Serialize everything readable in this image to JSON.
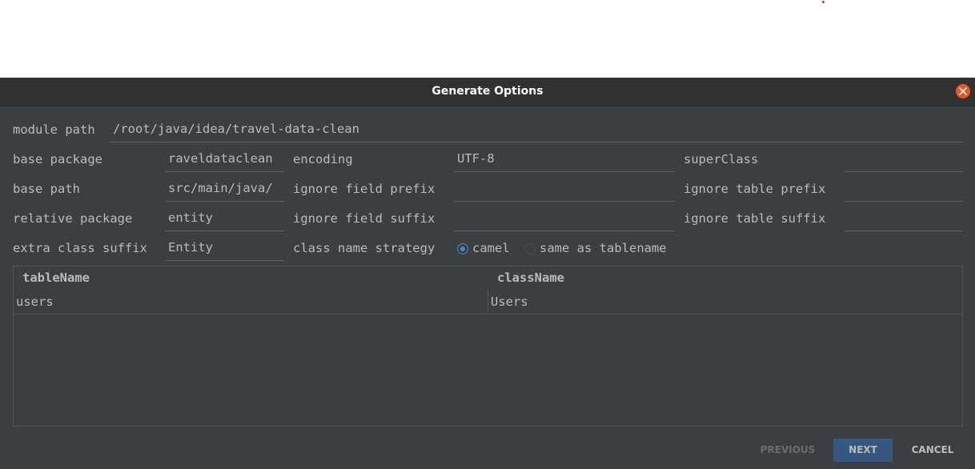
{
  "window": {
    "title": "Generate Options"
  },
  "form": {
    "module_path_label": "module path",
    "module_path_value": "/root/java/idea/travel-data-clean",
    "base_package_label": "base package",
    "base_package_value": "raveldataclean",
    "base_path_label": "base path",
    "base_path_value": "src/main/java/",
    "relative_package_label": "relative package",
    "relative_package_value": "entity",
    "extra_class_suffix_label": "extra class suffix",
    "extra_class_suffix_value": "Entity",
    "encoding_label": "encoding",
    "encoding_value": "UTF-8",
    "ignore_field_prefix_label": "ignore field prefix",
    "ignore_field_prefix_value": "",
    "ignore_field_suffix_label": "ignore field suffix",
    "ignore_field_suffix_value": "",
    "class_name_strategy_label": "class name strategy",
    "strategy_options": [
      {
        "label": "camel",
        "selected": true
      },
      {
        "label": "same as tablename",
        "selected": false
      }
    ],
    "superclass_label": "superClass",
    "superclass_value": "",
    "ignore_table_prefix_label": "ignore table prefix",
    "ignore_table_prefix_value": "",
    "ignore_table_suffix_label": "ignore table suffix",
    "ignore_table_suffix_value": ""
  },
  "table": {
    "columns": [
      "tableName",
      "className"
    ],
    "rows": [
      [
        "users",
        "Users"
      ]
    ]
  },
  "buttons": {
    "previous": "PREVIOUS",
    "next": "NEXT",
    "cancel": "CANCEL"
  },
  "colors": {
    "dialog_bg": "#3c3f41",
    "title_bg": "#2f3133",
    "accent": "#4a88c7",
    "primary_button": "#365880",
    "close_button": "#e95420"
  },
  "icons": {
    "close": "close-icon",
    "radio_selected": "radio-selected-icon",
    "radio_unselected": "radio-unselected-icon"
  }
}
